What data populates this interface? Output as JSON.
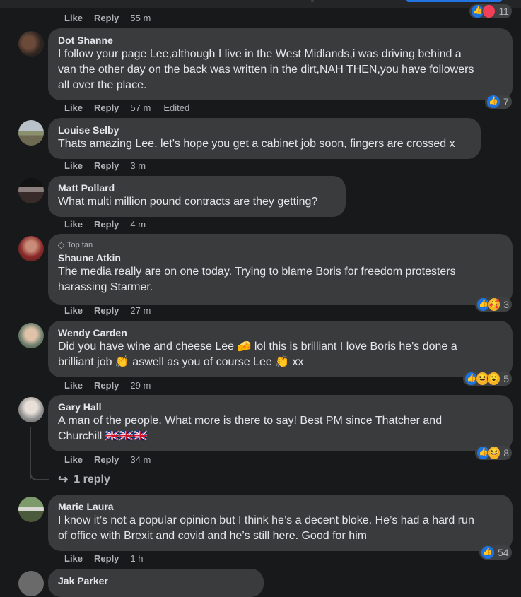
{
  "top": {
    "like": "Like",
    "reply": "Reply",
    "time": "55 m",
    "reaction_count": "11"
  },
  "comments": [
    {
      "author": "Dot Shanne",
      "text_1": "I follow your page Lee,although I live in the West Midlands,i was driving behind a",
      "text_2": "van the other day on the back was written in the dirt,NAH THEN,you have followers",
      "text_3": "all over the place.",
      "like": "Like",
      "reply": "Reply",
      "time": "57 m",
      "edited": "Edited",
      "reaction_count": "7"
    },
    {
      "author": "Louise Selby",
      "text_1": "Thats amazing Lee, let's hope you get a cabinet job soon, fingers are crossed x",
      "like": "Like",
      "reply": "Reply",
      "time": "3 m"
    },
    {
      "author": "Matt Pollard",
      "text_1": "What multi million pound contracts are they getting?",
      "like": "Like",
      "reply": "Reply",
      "time": "4 m"
    },
    {
      "badge": "Top fan",
      "author": "Shaune Atkin",
      "text_1": "The media really are on one today. Trying to blame Boris for freedom protesters",
      "text_2": "harassing Starmer.",
      "like": "Like",
      "reply": "Reply",
      "time": "27 m",
      "reaction_count": "3"
    },
    {
      "author": "Wendy Carden",
      "text_1": "Did you have wine and cheese Lee 🧀 lol this is brilliant I love Boris he's done a",
      "text_2": "brilliant job 👏 aswell as you of course Lee 👏 xx",
      "like": "Like",
      "reply": "Reply",
      "time": "29 m",
      "reaction_count": "5"
    },
    {
      "author": "Gary Hall",
      "text_1": "A man of the people. What more is there to say! Best PM since Thatcher and",
      "text_2": "Churchill 🇬🇧🇬🇧🇬🇧",
      "like": "Like",
      "reply": "Reply",
      "time": "34 m",
      "reaction_count": "8",
      "replies_link": "1 reply"
    },
    {
      "author": "Marie Laura",
      "text_1": "I know it’s not a popular opinion but I think he’s a decent bloke. He’s had a hard run",
      "text_2": "of office with Brexit and covid and he’s still here. Good for him",
      "like": "Like",
      "reply": "Reply",
      "time": "1 h",
      "reaction_count": "54"
    },
    {
      "author": "Jak Parker"
    }
  ]
}
